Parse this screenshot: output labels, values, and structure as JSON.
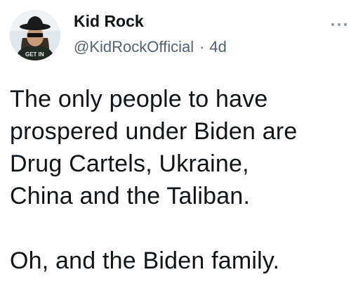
{
  "tweet": {
    "author": {
      "display_name": "Kid Rock",
      "handle": "@KidRockOfficial",
      "avatar_icon": "profile-photo-icon"
    },
    "separator": "·",
    "timestamp": "4d",
    "more_icon": "more-options-icon",
    "text": "The only people to have\nprospered under Biden are\nDrug Cartels, Ukraine,\nChina and the Taliban.\n\nOh, and the Biden family.",
    "colors": {
      "name": "#0f1419",
      "secondary": "#536471",
      "background": "#ffffff"
    }
  }
}
